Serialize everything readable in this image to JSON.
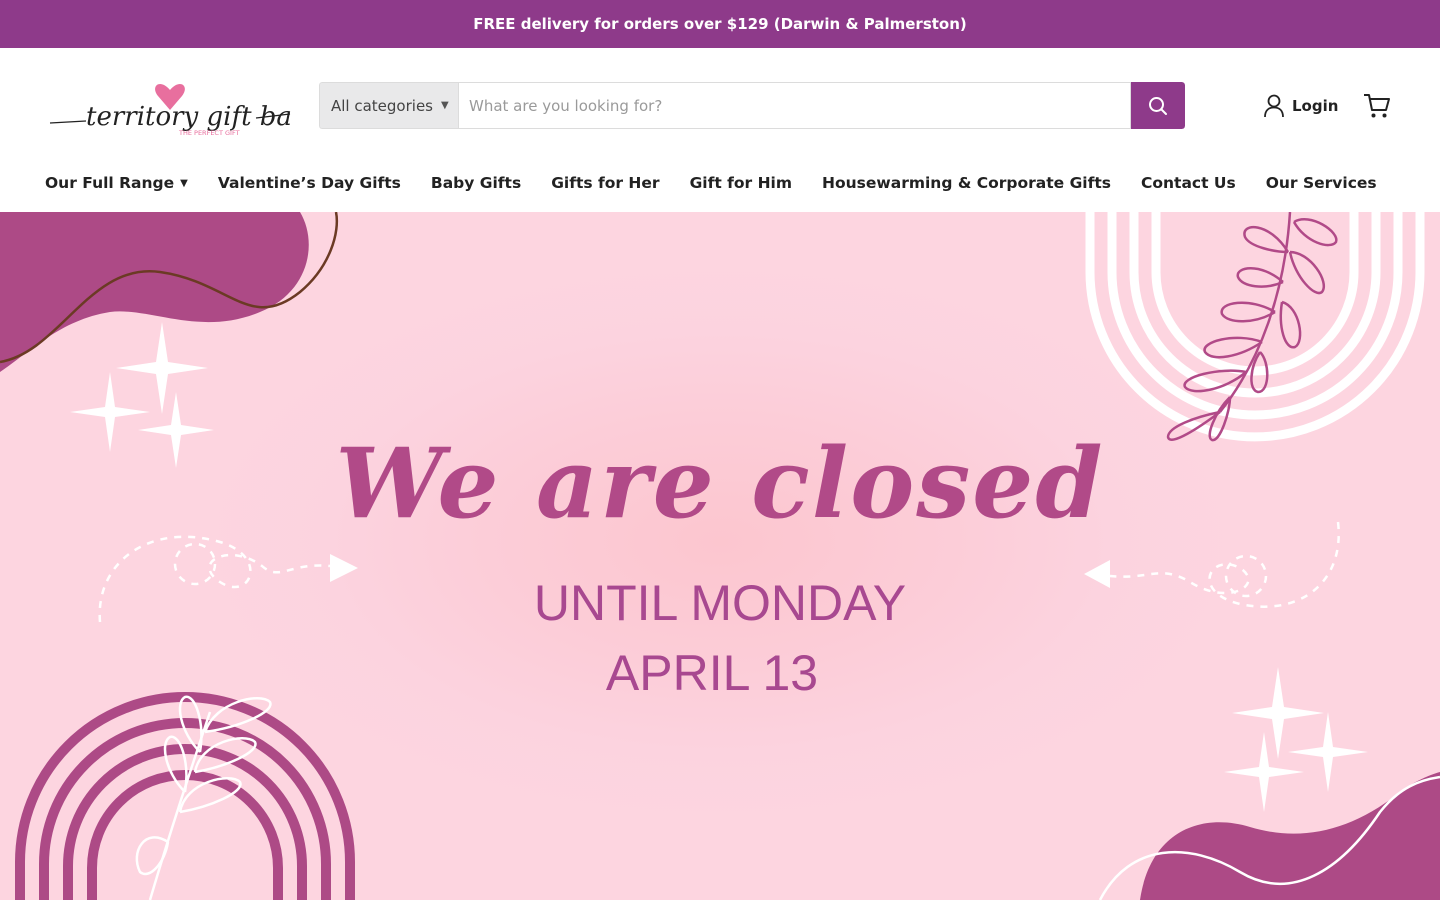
{
  "announcement": "FREE delivery for orders over $129 (Darwin & Palmerston)",
  "brand": {
    "name": "territory gift baskets",
    "tagline": "THE PERFECT GIFT",
    "primary_color": "#8e3a8a"
  },
  "search": {
    "category_label": "All categories",
    "placeholder": "What are you looking for?",
    "value": ""
  },
  "account": {
    "login_label": "Login"
  },
  "nav": {
    "items": [
      {
        "label": "Our Full Range",
        "has_dropdown": true
      },
      {
        "label": "Valentine’s Day Gifts"
      },
      {
        "label": "Baby Gifts"
      },
      {
        "label": "Gifts for Her"
      },
      {
        "label": "Gift for Him"
      },
      {
        "label": "Housewarming & Corporate Gifts"
      },
      {
        "label": "Contact Us"
      },
      {
        "label": "Our Services"
      }
    ]
  },
  "hero": {
    "heading": "We are closed",
    "line1": "UNTIL MONDAY",
    "line2": "APRIL 13",
    "accent_color": "#b14a88"
  }
}
